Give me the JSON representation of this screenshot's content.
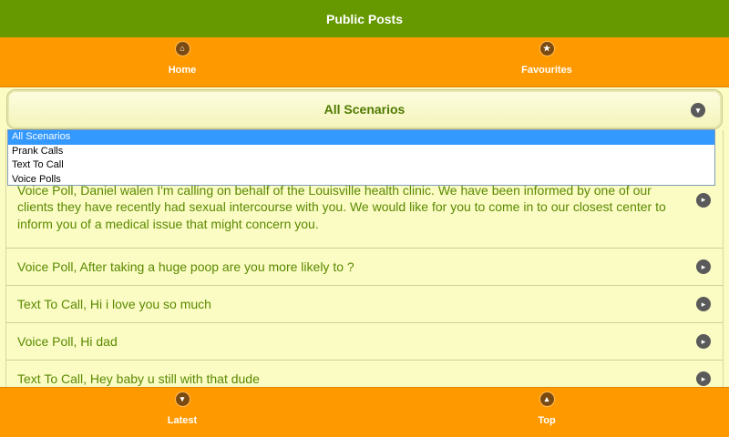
{
  "header": {
    "title": "Public Posts"
  },
  "top_nav": [
    {
      "label": "Home",
      "icon": "home-icon",
      "glyph": "⌂"
    },
    {
      "label": "Favourites",
      "icon": "star-icon",
      "glyph": "★"
    }
  ],
  "filter": {
    "selected": "All Scenarios",
    "options": [
      "All Scenarios",
      "Prank Calls",
      "Text To Call",
      "Voice Polls"
    ]
  },
  "posts": [
    {
      "text": "Voice Poll, Daniel walen I'm calling on behalf of the Louisville health clinic. We have been informed by one of our clients they have recently had sexual intercourse with you. We would like for you to come in to our closest center to inform you of a medical issue that might concern you."
    },
    {
      "text": "Voice Poll, After taking a huge poop are you more likely to ?"
    },
    {
      "text": "Text To Call, Hi i love you so much"
    },
    {
      "text": "Voice Poll, Hi dad"
    },
    {
      "text": "Text To Call, Hey baby u still with that dude"
    }
  ],
  "bottom_nav": [
    {
      "label": "Latest",
      "icon": "chevron-down-icon",
      "glyph": "▾"
    },
    {
      "label": "Top",
      "icon": "chevron-up-icon",
      "glyph": "▴"
    }
  ],
  "colors": {
    "header": "#669900",
    "tabs": "#ff9900",
    "background": "#fbfbc4",
    "text": "#5a8a00"
  }
}
